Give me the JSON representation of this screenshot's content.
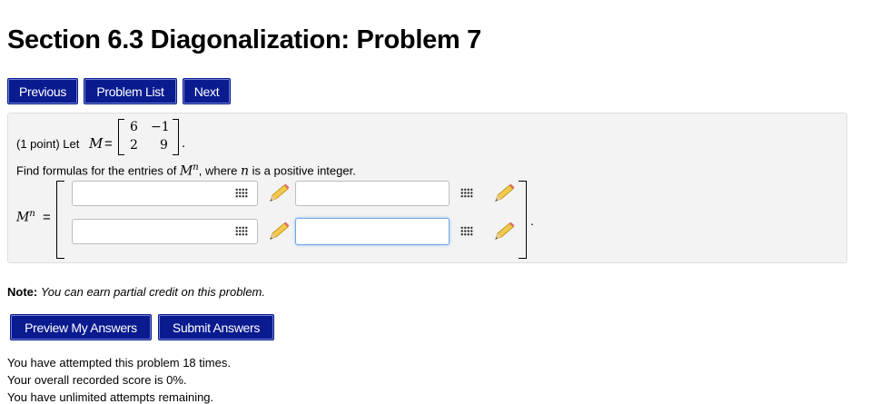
{
  "page": {
    "title": "Section 6.3 Diagonalization: Problem 7"
  },
  "nav": {
    "previous": "Previous",
    "problem_list": "Problem List",
    "next": "Next"
  },
  "problem": {
    "points": "(1 point) Let",
    "matrix_var": "M",
    "equals": "=",
    "matrix": [
      [
        "6",
        "−1"
      ],
      [
        "2",
        "9"
      ]
    ],
    "period": ".",
    "instruction_prefix": "Find formulas for the entries of",
    "instruction_var": "M",
    "instruction_sup": "n",
    "instruction_mid": ", where",
    "instruction_var2": "n",
    "instruction_suffix": "is a positive integer.",
    "answer_var": "M",
    "answer_sup": "n",
    "answer_equals": "=",
    "answers": [
      "",
      "",
      "",
      ""
    ],
    "answer_period": "."
  },
  "note": {
    "label": "Note:",
    "text": "You can earn partial credit on this problem."
  },
  "actions": {
    "preview": "Preview My Answers",
    "submit": "Submit Answers"
  },
  "status": [
    "You have attempted this problem 18 times.",
    "Your overall recorded score is 0%.",
    "You have unlimited attempts remaining."
  ]
}
